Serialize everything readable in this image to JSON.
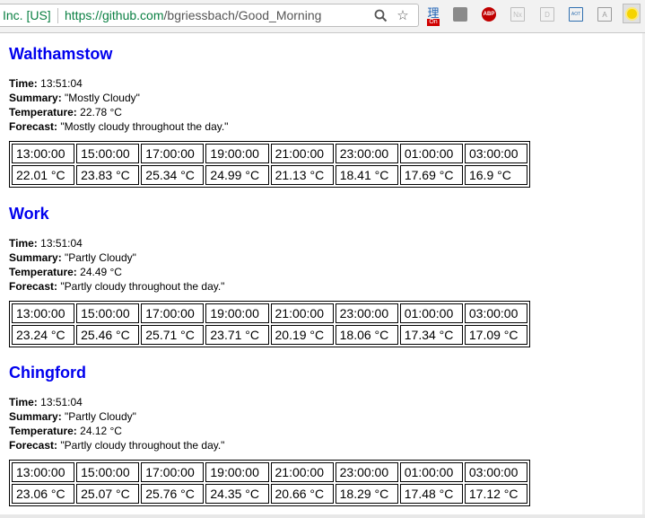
{
  "browser": {
    "secure_label": "Inc. [US]",
    "url_host": "https://github.com",
    "url_path": "/bgriessbach/Good_Morning",
    "zoom_icon": "zoom-icon",
    "star_icon": "star-icon",
    "extensions": [
      {
        "name": "rikaikun-extension-icon",
        "glyph": "理",
        "badge": "On",
        "color": "#1a5fb4"
      },
      {
        "name": "gray-extension-icon",
        "glyph": "",
        "color": "#8a8a8a"
      },
      {
        "name": "adblock-plus-icon",
        "glyph": "ABP",
        "color": "#c00000"
      },
      {
        "name": "nx-extension-icon",
        "glyph": "Nx",
        "color": "#bdbdbd"
      },
      {
        "name": "document-extension-icon",
        "glyph": "D",
        "color": "#bdbdbd"
      },
      {
        "name": "aot-extension-icon",
        "glyph": "AOT",
        "color": "#2f6fb0"
      },
      {
        "name": "pdf-extension-icon",
        "glyph": "A",
        "color": "#9a9a9a"
      },
      {
        "name": "good-morning-sun-icon",
        "glyph": "",
        "color": "#f5d400"
      }
    ]
  },
  "labels": {
    "time": "Time:",
    "summary": "Summary:",
    "temperature": "Temperature:",
    "forecast": "Forecast:"
  },
  "locations": [
    {
      "name": "Walthamstow",
      "time": "13:51:04",
      "summary": "\"Mostly Cloudy\"",
      "temperature": "22.78 °C",
      "forecast": "\"Mostly cloudy throughout the day.\"",
      "hours": [
        "13:00:00",
        "15:00:00",
        "17:00:00",
        "19:00:00",
        "21:00:00",
        "23:00:00",
        "01:00:00",
        "03:00:00"
      ],
      "temps": [
        "22.01 °C",
        "23.83 °C",
        "25.34 °C",
        "24.99 °C",
        "21.13 °C",
        "18.41 °C",
        "17.69 °C",
        "16.9 °C"
      ]
    },
    {
      "name": "Work",
      "time": "13:51:04",
      "summary": "\"Partly Cloudy\"",
      "temperature": "24.49 °C",
      "forecast": "\"Partly cloudy throughout the day.\"",
      "hours": [
        "13:00:00",
        "15:00:00",
        "17:00:00",
        "19:00:00",
        "21:00:00",
        "23:00:00",
        "01:00:00",
        "03:00:00"
      ],
      "temps": [
        "23.24 °C",
        "25.46 °C",
        "25.71 °C",
        "23.71 °C",
        "20.19 °C",
        "18.06 °C",
        "17.34 °C",
        "17.09 °C"
      ]
    },
    {
      "name": "Chingford",
      "time": "13:51:04",
      "summary": "\"Partly Cloudy\"",
      "temperature": "24.12 °C",
      "forecast": "\"Partly cloudy throughout the day.\"",
      "hours": [
        "13:00:00",
        "15:00:00",
        "17:00:00",
        "19:00:00",
        "21:00:00",
        "23:00:00",
        "01:00:00",
        "03:00:00"
      ],
      "temps": [
        "23.06 °C",
        "25.07 °C",
        "25.76 °C",
        "24.35 °C",
        "20.66 °C",
        "18.29 °C",
        "17.48 °C",
        "17.12 °C"
      ]
    }
  ]
}
